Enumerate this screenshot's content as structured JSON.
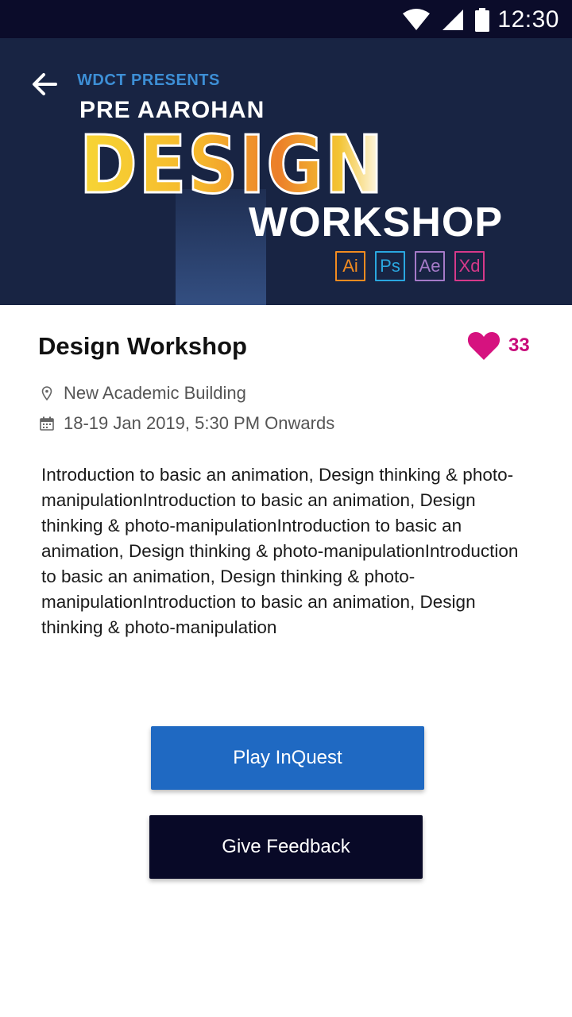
{
  "status_bar": {
    "time": "12:30",
    "icons": [
      "wifi-icon",
      "cell-signal-icon",
      "battery-icon"
    ]
  },
  "banner": {
    "presents": "WDCT PRESENTS",
    "pre_title": "PRE AAROHAN",
    "design_word": "DESIGN",
    "workshop_word": "WORKSHOP",
    "app_badges": [
      {
        "label": "Ai",
        "color": "#f28b20"
      },
      {
        "label": "Ps",
        "color": "#2aa7e0"
      },
      {
        "label": "Ae",
        "color": "#a57ac8"
      },
      {
        "label": "Xd",
        "color": "#d6398a"
      }
    ],
    "background": "#182443"
  },
  "event": {
    "title": "Design Workshop",
    "likes": "33",
    "location": "New Academic Building",
    "date": "18-19 Jan 2019, 5:30 PM Onwards",
    "description": "Introduction to basic an animation, Design thinking & photo-manipulationIntroduction to basic an animation, Design thinking & photo-manipulationIntroduction to basic an animation, Design thinking & photo-manipulationIntroduction to basic an animation, Design thinking & photo-manipulationIntroduction to basic an animation, Design thinking & photo-manipulation"
  },
  "actions": {
    "play_label": "Play InQuest",
    "feedback_label": "Give Feedback"
  },
  "colors": {
    "accent": "#1f69c2",
    "heart": "#d6127f",
    "dark": "#080927"
  }
}
